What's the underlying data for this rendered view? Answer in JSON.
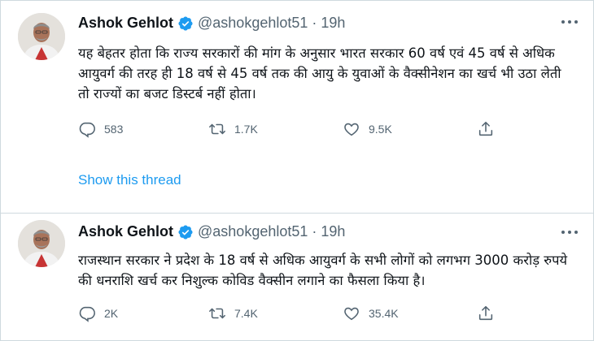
{
  "colors": {
    "accent": "#1d9bf0",
    "text": "#0f1419",
    "secondary": "#536471",
    "border": "#cfd9de"
  },
  "tweets": [
    {
      "name": "Ashok Gehlot",
      "handle": "@ashokgehlot51",
      "separator": "·",
      "time": "19h",
      "verified_icon": "verified-badge-icon",
      "text": "यह बेहतर होता कि राज्य सरकारों की मांग के अनुसार भारत सरकार 60 वर्ष एवं 45 वर्ष से अधिक आयुवर्ग की तरह ही 18 वर्ष से 45 वर्ष तक की आयु के युवाओं के वैक्सीनेशन का खर्च भी उठा लेती तो राज्यों का बजट डिस्टर्ब नहीं होता।",
      "replies": "583",
      "retweets": "1.7K",
      "likes": "9.5K",
      "show_thread": "Show this thread"
    },
    {
      "name": "Ashok Gehlot",
      "handle": "@ashokgehlot51",
      "separator": "·",
      "time": "19h",
      "verified_icon": "verified-badge-icon",
      "text": "राजस्थान सरकार ने प्रदेश के 18 वर्ष से अधिक आयुवर्ग के सभी लोगों को लगभग 3000 करोड़ रुपये की धनराशि खर्च कर निशुल्क कोविड वैक्सीन लगाने का फैसला किया है।",
      "replies": "2K",
      "retweets": "7.4K",
      "likes": "35.4K"
    }
  ]
}
